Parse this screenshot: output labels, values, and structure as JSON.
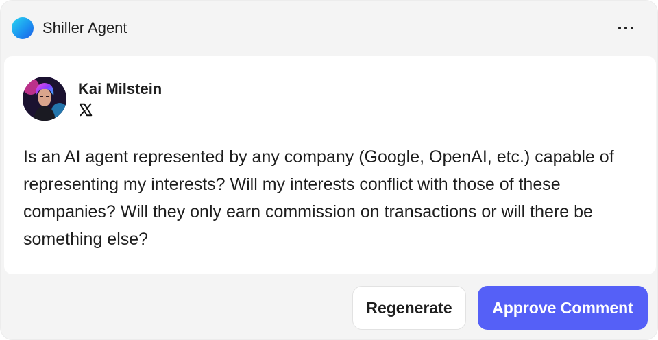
{
  "header": {
    "agent_name": "Shiller Agent",
    "agent_color": "#1b8ff0",
    "more_icon": "more-horizontal-icon"
  },
  "comment": {
    "author_name": "Kai Milstein",
    "platform_icon": "x-logo-icon",
    "text": "Is an AI agent represented by any company (Google, OpenAI, etc.) capable of representing my interests? Will my interests conflict with those of these companies? Will they only earn commission on transactions or will there be something else?"
  },
  "actions": {
    "regenerate_label": "Regenerate",
    "approve_label": "Approve Comment",
    "approve_color": "#5560f7"
  }
}
